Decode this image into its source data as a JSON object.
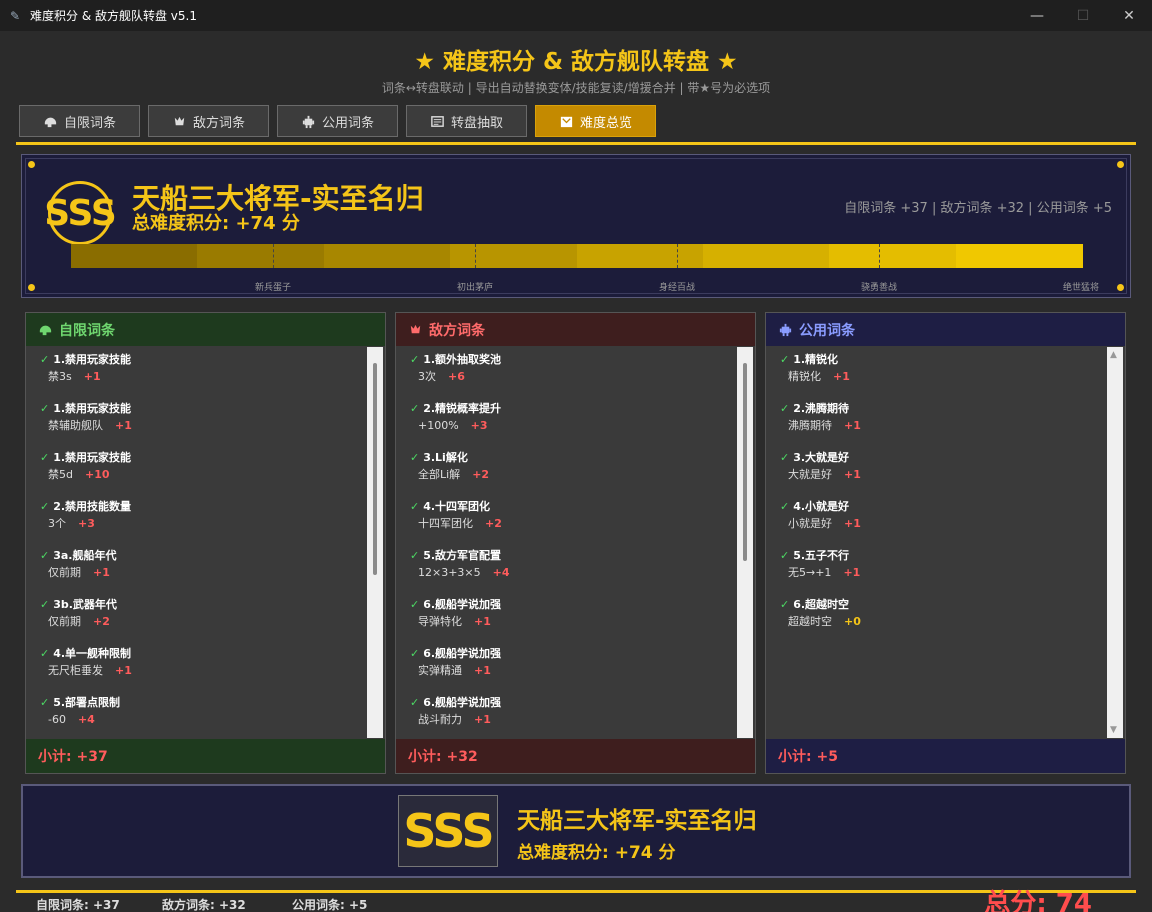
{
  "window": {
    "title": "难度积分 & 敌方舰队转盘 v5.1",
    "minimize": "—",
    "maximize": "☐",
    "close": "✕"
  },
  "header": {
    "title": "★ 难度积分 & 敌方舰队转盘 ★",
    "subtitle": "词条↔转盘联动 | 导出自动替换变体/技能复读/增援合并 | 带★号为必选项"
  },
  "tabs": [
    {
      "label": "自限词条",
      "icon": "helmet-icon"
    },
    {
      "label": "敌方词条",
      "icon": "enemy-ship-icon"
    },
    {
      "label": "公用词条",
      "icon": "robot-icon"
    },
    {
      "label": "转盘抽取",
      "icon": "ticket-icon"
    },
    {
      "label": "难度总览",
      "icon": "overview-icon",
      "active": true
    }
  ],
  "rank": {
    "badge": "SSS",
    "title": "天船三大将军-实至名归",
    "score": "总难度积分: +74 分",
    "breakdown": "自限词条 +37 | 敌方词条 +32 | 公用词条 +5"
  },
  "difficulty_bar": {
    "labels": [
      "新兵蛋子",
      "初出茅庐",
      "身经百战",
      "骁勇善战",
      "绝世猛将"
    ],
    "colors": [
      "#8a6d00",
      "#9a7b00",
      "#a88700",
      "#b89500",
      "#c8a300",
      "#d6b000",
      "#e4bd00",
      "#f0c800"
    ]
  },
  "panels": [
    {
      "key": "self",
      "title": "自限词条",
      "icon": "helmet-icon",
      "head_bg": "#1e3a1e",
      "head_color": "#6fd66f",
      "foot_bg": "#1e3a1e",
      "subtotal": "小计: +37",
      "items": [
        {
          "name": "1.禁用玩家技能",
          "value": "禁3s",
          "points": "+1"
        },
        {
          "name": "1.禁用玩家技能",
          "value": "禁辅助舰队",
          "points": "+1"
        },
        {
          "name": "1.禁用玩家技能",
          "value": "禁5d",
          "points": "+10"
        },
        {
          "name": "2.禁用技能数量",
          "value": "3个",
          "points": "+3"
        },
        {
          "name": "3a.舰船年代",
          "value": "仅前期",
          "points": "+1"
        },
        {
          "name": "3b.武器年代",
          "value": "仅前期",
          "points": "+2"
        },
        {
          "name": "4.单一舰种限制",
          "value": "无尺柜垂发",
          "points": "+1"
        },
        {
          "name": "5.部署点限制",
          "value": "-60",
          "points": "+4"
        }
      ]
    },
    {
      "key": "enemy",
      "title": "敌方词条",
      "icon": "enemy-ship-icon",
      "head_bg": "#3e1e1e",
      "head_color": "#ff6b6b",
      "foot_bg": "#3e1e1e",
      "subtotal": "小计: +32",
      "items": [
        {
          "name": "1.额外抽取奖池",
          "value": "3次",
          "points": "+6"
        },
        {
          "name": "2.精锐概率提升",
          "value": "+100%",
          "points": "+3"
        },
        {
          "name": "3.Li解化",
          "value": "全部Li解",
          "points": "+2"
        },
        {
          "name": "4.十四军团化",
          "value": "十四军团化",
          "points": "+2"
        },
        {
          "name": "5.敌方军官配置",
          "value": "12×3+3×5",
          "points": "+4"
        },
        {
          "name": "6.舰船学说加强",
          "value": "导弹特化",
          "points": "+1"
        },
        {
          "name": "6.舰船学说加强",
          "value": "实弹精通",
          "points": "+1"
        },
        {
          "name": "6.舰船学说加强",
          "value": "战斗耐力",
          "points": "+1"
        }
      ]
    },
    {
      "key": "common",
      "title": "公用词条",
      "icon": "robot-icon",
      "head_bg": "#1e1e44",
      "head_color": "#8a9cff",
      "foot_bg": "#1e1e44",
      "subtotal": "小计: +5",
      "items": [
        {
          "name": "1.精锐化",
          "value": "精锐化",
          "points": "+1"
        },
        {
          "name": "2.沸腾期待",
          "value": "沸腾期待",
          "points": "+1"
        },
        {
          "name": "3.大就是好",
          "value": "大就是好",
          "points": "+1"
        },
        {
          "name": "4.小就是好",
          "value": "小就是好",
          "points": "+1"
        },
        {
          "name": "5.五子不行",
          "value": "无5→+1",
          "points": "+1"
        },
        {
          "name": "6.超越时空",
          "value": "超越时空",
          "points": "+0"
        }
      ]
    }
  ],
  "summary_card": {
    "badge": "SSS",
    "title": "天船三大将军-实至名归",
    "score": "总难度积分: +74 分"
  },
  "status": {
    "self": "自限词条: +37",
    "enemy": "敌方词条: +32",
    "common": "公用词条: +5",
    "total": "总分: 74"
  },
  "colors": {
    "accent": "#f5c518",
    "positive": "#ff5c5c",
    "check": "#4cd964"
  }
}
